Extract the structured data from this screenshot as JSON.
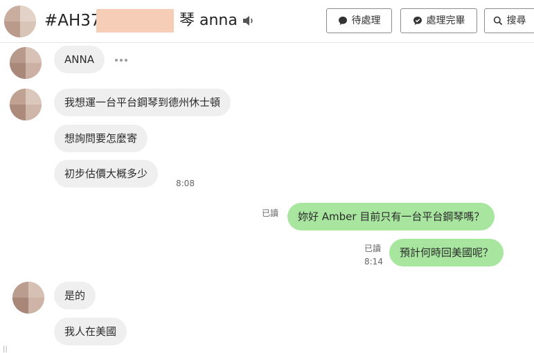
{
  "header": {
    "title_prefix": "#AH37",
    "title_suffix": "琴 anna",
    "buttons": {
      "pending": "待處理",
      "done": "處理完畢",
      "search": "搜尋"
    }
  },
  "messages": {
    "name_tag": "ANNA",
    "m1": "我想運一台平台鋼琴到德州休士頓",
    "m2": "想詢問要怎麼寄",
    "m3": "初步估價大概多少",
    "t1": "8:08",
    "o1": "妳好 Amber 目前只有一台平台鋼琴嗎？",
    "o1_read": "已讀",
    "o2": "預計何時回美國呢？",
    "o2_read": "已讀",
    "t2": "8:14",
    "m4": "是的",
    "m5": "我人在美國"
  },
  "colors": {
    "incoming_bubble": "#efefef",
    "outgoing_bubble": "#a8e6a0"
  },
  "icons": {
    "speaker": "speaker-icon",
    "pending": "chat-bubble-icon",
    "done": "check-bubble-icon",
    "search": "search-icon"
  }
}
